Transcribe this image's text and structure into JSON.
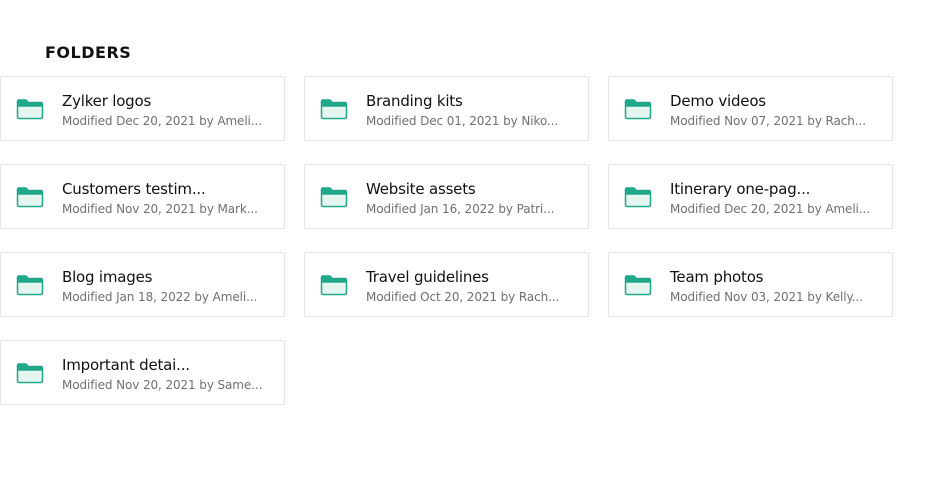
{
  "section": {
    "title": "FOLDERS"
  },
  "colors": {
    "folder_accent": "#1fa88a",
    "folder_fill": "#e6f6f1"
  },
  "folders": [
    {
      "name": "Zylker logos",
      "meta": "Modified Dec 20, 2021 by Ameli...",
      "icon": "folder-icon"
    },
    {
      "name": "Branding kits",
      "meta": "Modified Dec 01, 2021 by Niko...",
      "icon": "folder-icon"
    },
    {
      "name": "Demo videos",
      "meta": "Modified Nov 07, 2021 by Rach...",
      "icon": "folder-icon"
    },
    {
      "name": "Customers testim...",
      "meta": "Modified Nov 20, 2021 by Mark...",
      "icon": "folder-icon"
    },
    {
      "name": "Website assets",
      "meta": "Modified Jan 16, 2022 by Patri...",
      "icon": "folder-icon"
    },
    {
      "name": "Itinerary one-pag...",
      "meta": "Modified Dec 20, 2021 by Ameli...",
      "icon": "folder-icon"
    },
    {
      "name": "Blog images",
      "meta": "Modified Jan 18, 2022 by Ameli...",
      "icon": "folder-icon"
    },
    {
      "name": "Travel guidelines",
      "meta": "Modified Oct 20, 2021 by Rach...",
      "icon": "folder-icon"
    },
    {
      "name": "Team photos",
      "meta": "Modified Nov 03, 2021 by Kelly...",
      "icon": "folder-icon"
    },
    {
      "name": "Important detai...",
      "meta": "Modified Nov 20, 2021 by Same...",
      "icon": "folder-icon"
    }
  ]
}
